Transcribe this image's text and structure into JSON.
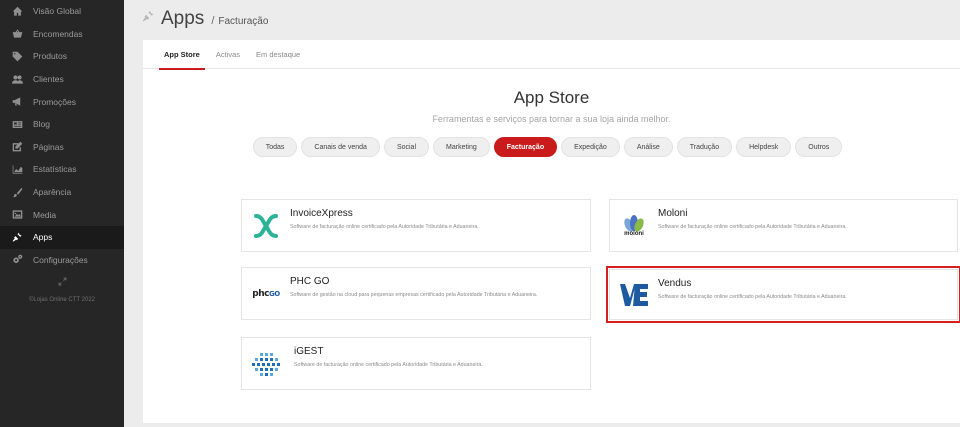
{
  "sidebar": {
    "items": [
      {
        "label": "Visão Global",
        "icon": "home-icon",
        "active": false
      },
      {
        "label": "Encomendas",
        "icon": "basket-icon",
        "active": false
      },
      {
        "label": "Produtos",
        "icon": "tag-icon",
        "active": false
      },
      {
        "label": "Clientes",
        "icon": "users-icon",
        "active": false
      },
      {
        "label": "Promoções",
        "icon": "megaphone-icon",
        "active": false
      },
      {
        "label": "Blog",
        "icon": "newspaper-icon",
        "active": false
      },
      {
        "label": "Páginas",
        "icon": "edit-icon",
        "active": false
      },
      {
        "label": "Estatísticas",
        "icon": "area-chart-icon",
        "active": false
      },
      {
        "label": "Aparência",
        "icon": "brush-icon",
        "active": false
      },
      {
        "label": "Media",
        "icon": "image-icon",
        "active": false
      },
      {
        "label": "Apps",
        "icon": "plug-icon",
        "active": true
      },
      {
        "label": "Configurações",
        "icon": "cogs-icon",
        "active": false
      }
    ],
    "footer": "©Lojas Online CTT 2022"
  },
  "header": {
    "title": "Apps",
    "separator": "/",
    "breadcrumb": "Facturação"
  },
  "tabs": [
    "App Store",
    "Activas",
    "Em destaque"
  ],
  "store": {
    "title": "App Store",
    "subtitle": "Ferramentas e serviços para tornar a sua loja ainda melhor."
  },
  "filters": [
    "Todas",
    "Canais de venda",
    "Social",
    "Marketing",
    "Facturação",
    "Expedição",
    "Análise",
    "Tradução",
    "Helpdesk",
    "Outros"
  ],
  "active_filter": "Facturação",
  "apps": [
    {
      "name": "InvoiceXpress",
      "desc": "Software de facturação online certificado pela Autoridade Tributária e Aduaneira."
    },
    {
      "name": "Moloni",
      "desc": "Software de facturação online certificado pela Autoridade Tributária e Aduaneira.",
      "logo_text": "moloni"
    },
    {
      "name": "PHC GO",
      "desc": "Software de gestão na cloud para pequenas empresas certificado pela Autoridade Tributária e Aduaneira.",
      "logo_text": "phc",
      "logo_text2": "GO"
    },
    {
      "name": "Vendus",
      "desc": "Software de facturação online certificado pela Autoridade Tributária e Aduaneira."
    },
    {
      "name": "iGEST",
      "desc": "Software de facturação online certificado pela Autoridade Tributária e Aduaneira."
    }
  ],
  "colors": {
    "accent": "#c91b1b",
    "sidebar_bg": "#262626",
    "invoicexpress": "#2bb397",
    "vendus": "#1e5aa0",
    "igest": "#1f6fb5"
  }
}
